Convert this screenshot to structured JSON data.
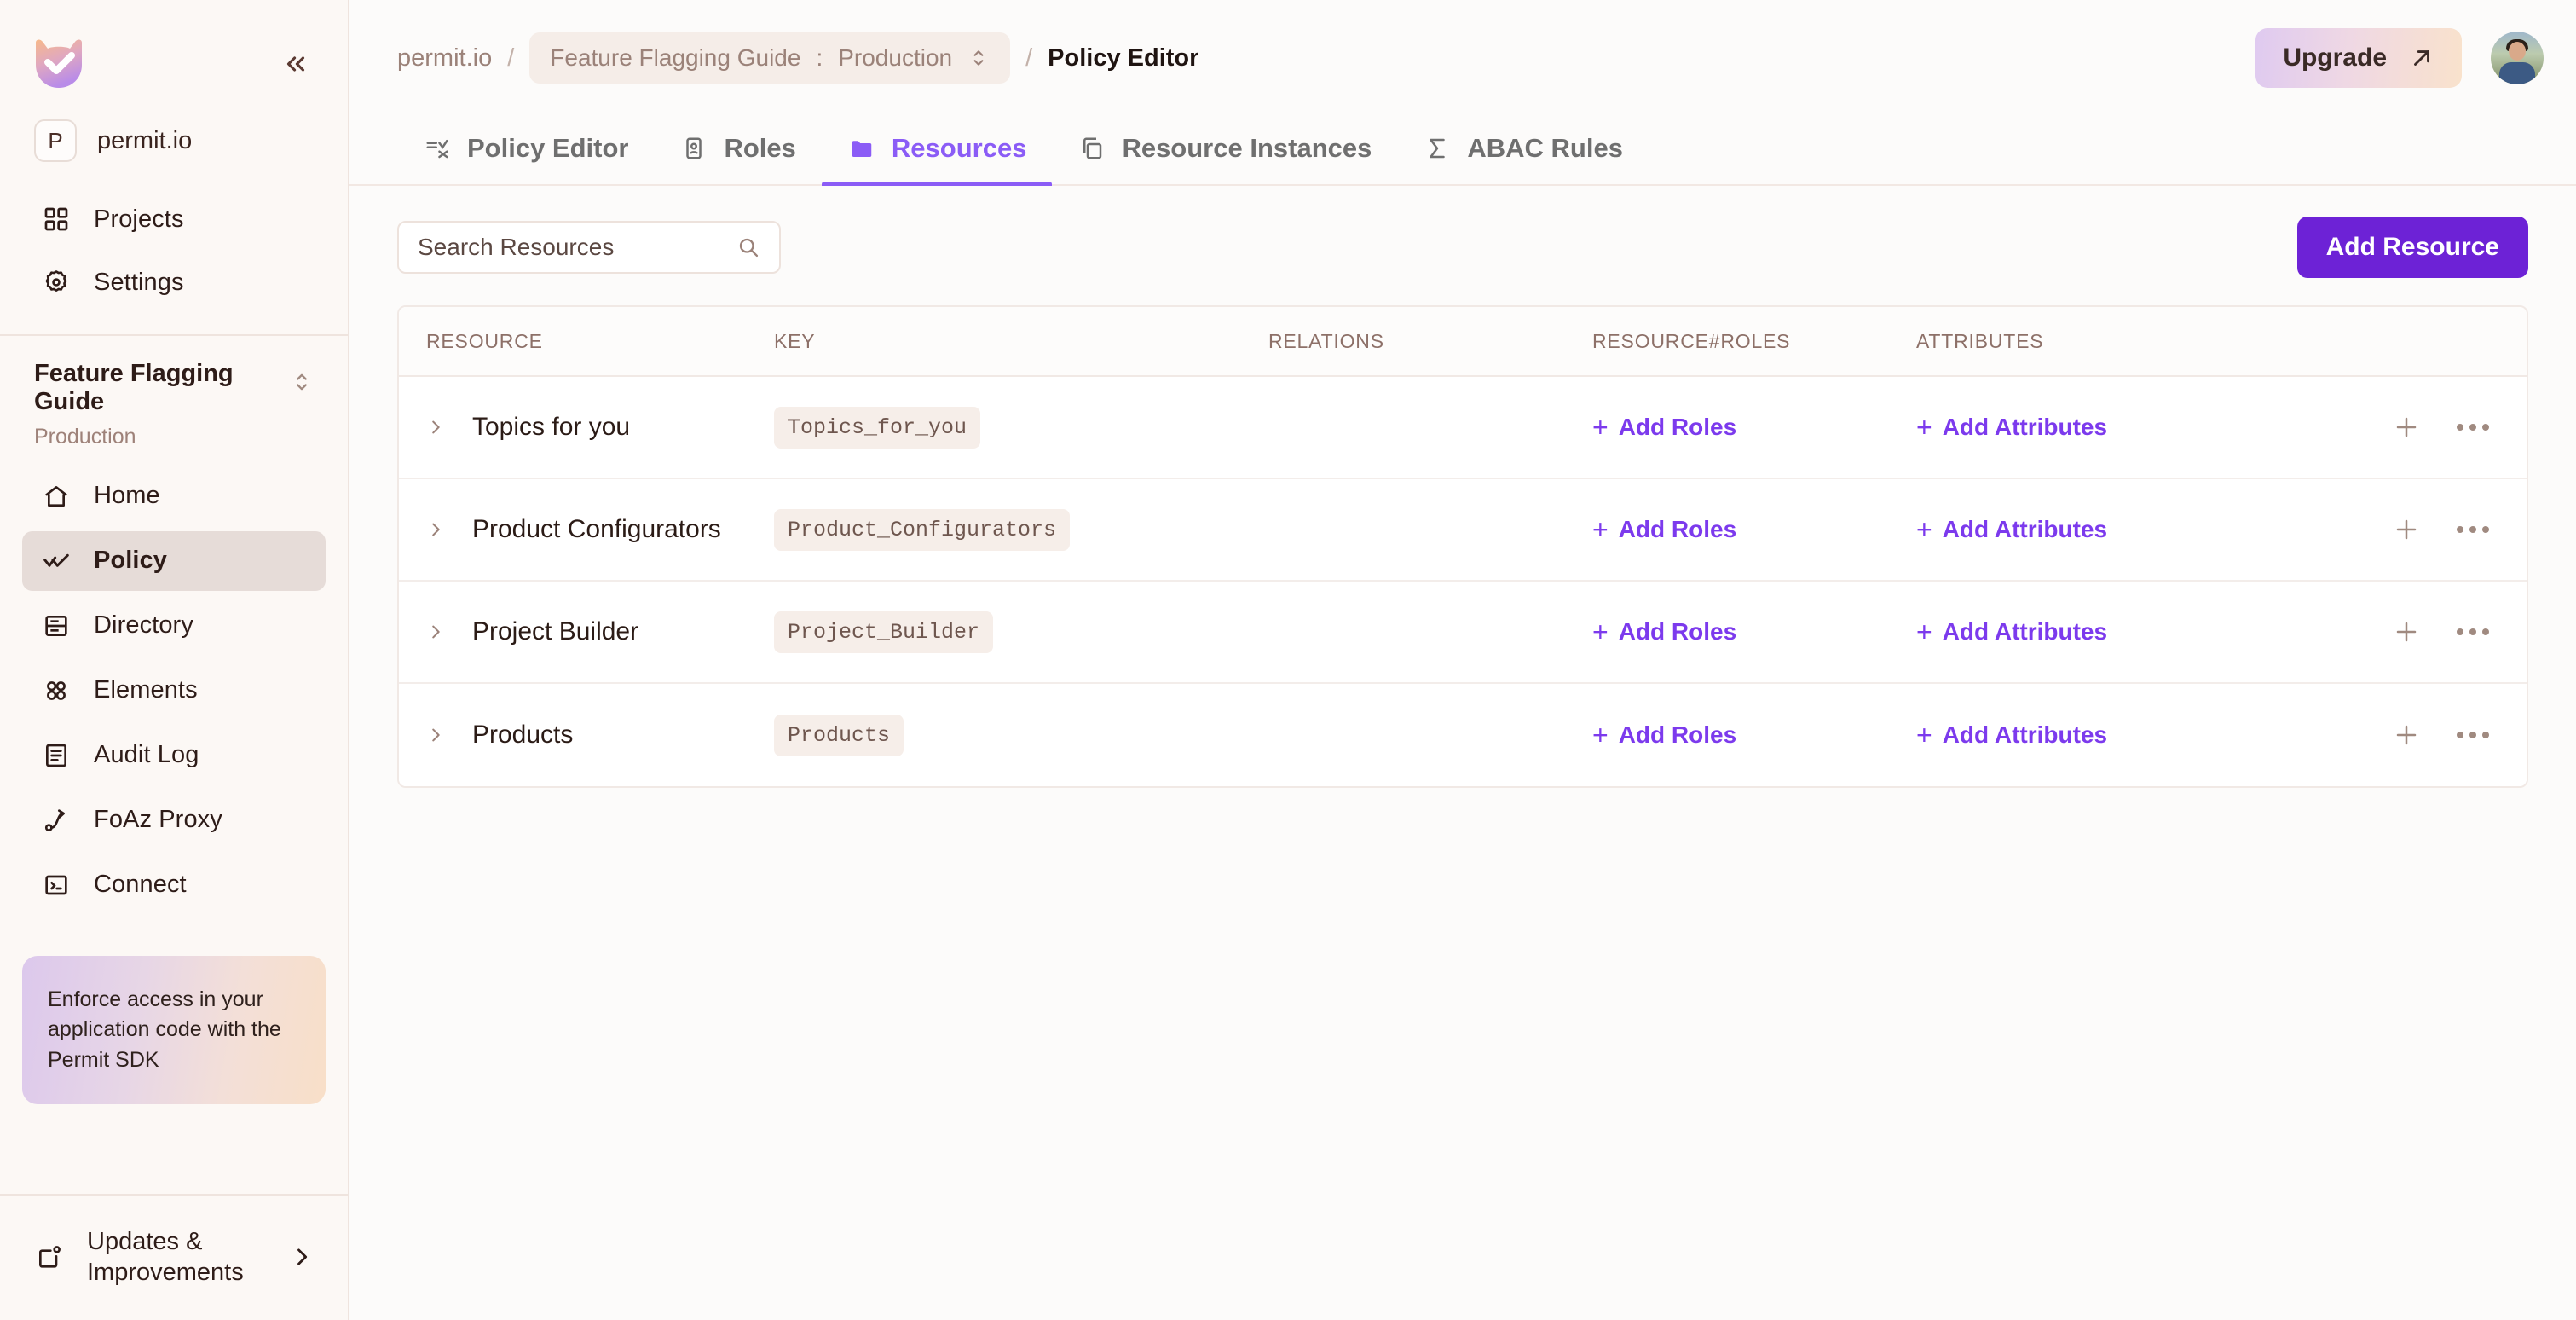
{
  "sidebar": {
    "logo_icon": "permit-logo-icon",
    "collapse_icon": "double-chevron-left-icon",
    "org": {
      "badge": "P",
      "name": "permit.io"
    },
    "top_nav": [
      {
        "label": "Projects",
        "icon": "grid-icon"
      },
      {
        "label": "Settings",
        "icon": "gear-icon"
      }
    ],
    "project": {
      "name": "Feature Flagging Guide",
      "environment": "Production",
      "switch_icon": "chevron-updown-icon"
    },
    "main_nav": [
      {
        "label": "Home",
        "icon": "home-icon",
        "active": false
      },
      {
        "label": "Policy",
        "icon": "policy-check-icon",
        "active": true
      },
      {
        "label": "Directory",
        "icon": "directory-icon",
        "active": false
      },
      {
        "label": "Elements",
        "icon": "elements-dots-icon",
        "active": false
      },
      {
        "label": "Audit Log",
        "icon": "audit-log-icon",
        "active": false
      },
      {
        "label": "FoAz Proxy",
        "icon": "foaz-proxy-icon",
        "active": false
      },
      {
        "label": "Connect",
        "icon": "terminal-icon",
        "active": false
      }
    ],
    "promo": {
      "text": "Enforce access in your application code with the Permit SDK"
    },
    "bottom": {
      "label": "Updates & Improvements",
      "icon": "announcement-icon",
      "chevron_icon": "chevron-right-icon"
    }
  },
  "header": {
    "breadcrumb": {
      "org": "permit.io",
      "separator": "/",
      "env_project": "Feature Flagging Guide",
      "env_colon": ":",
      "env_name": "Production",
      "env_switch_icon": "chevron-updown-icon",
      "page": "Policy Editor"
    },
    "upgrade": {
      "label": "Upgrade",
      "icon": "arrow-up-right-icon"
    },
    "avatar": "user-avatar"
  },
  "tabs": [
    {
      "label": "Policy Editor",
      "icon": "policy-editor-icon",
      "active": false
    },
    {
      "label": "Roles",
      "icon": "roles-badge-icon",
      "active": false
    },
    {
      "label": "Resources",
      "icon": "folder-icon",
      "active": true
    },
    {
      "label": "Resource Instances",
      "icon": "copy-icon",
      "active": false
    },
    {
      "label": "ABAC Rules",
      "icon": "sigma-icon",
      "active": false
    }
  ],
  "toolbar": {
    "search_placeholder": "Search Resources",
    "search_value": "",
    "search_icon": "search-icon",
    "add_resource_label": "Add Resource"
  },
  "table": {
    "columns": [
      "RESOURCE",
      "KEY",
      "RELATIONS",
      "RESOURCE#ROLES",
      "ATTRIBUTES"
    ],
    "row_actions": {
      "add_icon": "plus-icon",
      "more_icon": "ellipsis-icon"
    },
    "rows": [
      {
        "expand_icon": "chevron-right-icon",
        "resource": "Topics for you",
        "key": "Topics_for_you",
        "relations": "",
        "roles_link": "Add Roles",
        "attributes_link": "Add Attributes"
      },
      {
        "expand_icon": "chevron-right-icon",
        "resource": "Product Configurators",
        "key": "Product_Configurators",
        "relations": "",
        "roles_link": "Add Roles",
        "attributes_link": "Add Attributes"
      },
      {
        "expand_icon": "chevron-right-icon",
        "resource": "Project Builder",
        "key": "Project_Builder",
        "relations": "",
        "roles_link": "Add Roles",
        "attributes_link": "Add Attributes"
      },
      {
        "expand_icon": "chevron-right-icon",
        "resource": "Products",
        "key": "Products",
        "relations": "",
        "roles_link": "Add Roles",
        "attributes_link": "Add Attributes"
      }
    ]
  },
  "colors": {
    "accent_purple": "#8B5CF6",
    "button_purple": "#6D22D6",
    "link_purple": "#7C3AED",
    "sidebar_bg": "#FCF8F5",
    "active_nav_bg": "#E6DCD8",
    "muted_text": "#9B8279"
  }
}
